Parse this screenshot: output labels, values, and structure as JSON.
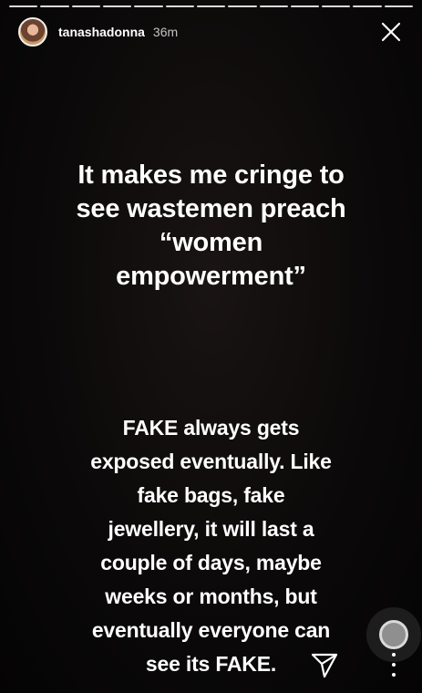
{
  "story": {
    "segments_total": 13,
    "segments_viewed": 13,
    "username": "tanashadonna",
    "time_ago": "36m"
  },
  "content": {
    "headline": "It makes me cringe to\nsee wastemen preach\n“women\nempowerment”",
    "body": "FAKE always gets\nexposed eventually. Like\nfake bags, fake\njewellery, it will last a\ncouple of days, maybe\nweeks or months, but\neventually everyone can\nsee its FAKE."
  },
  "icons": {
    "close": "close-icon",
    "send": "send-icon",
    "more": "more-vertical-icon",
    "camera": "floating-camera-button"
  },
  "colors": {
    "background": "#0b0909",
    "text": "#ffffff"
  }
}
